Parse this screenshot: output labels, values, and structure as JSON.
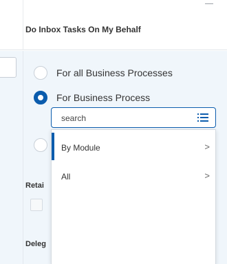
{
  "dialog": {
    "title": "Do Inbox Tasks On My Behalf"
  },
  "options": {
    "all_processes": "For all Business Processes",
    "business_process": "For Business Process",
    "selected": "For Business Process"
  },
  "search": {
    "placeholder": "search",
    "value": "search"
  },
  "menu": {
    "items": [
      {
        "label": "By Module",
        "chevron": ">"
      },
      {
        "label": "All",
        "chevron": ">"
      }
    ]
  },
  "side_labels": {
    "retain": "Retai",
    "delegate": "Deleg"
  },
  "colors": {
    "accent": "#0b5cad",
    "panel_bg": "#f0f6fb"
  },
  "icons": {
    "list": "list-icon",
    "close": "minimize-line"
  }
}
